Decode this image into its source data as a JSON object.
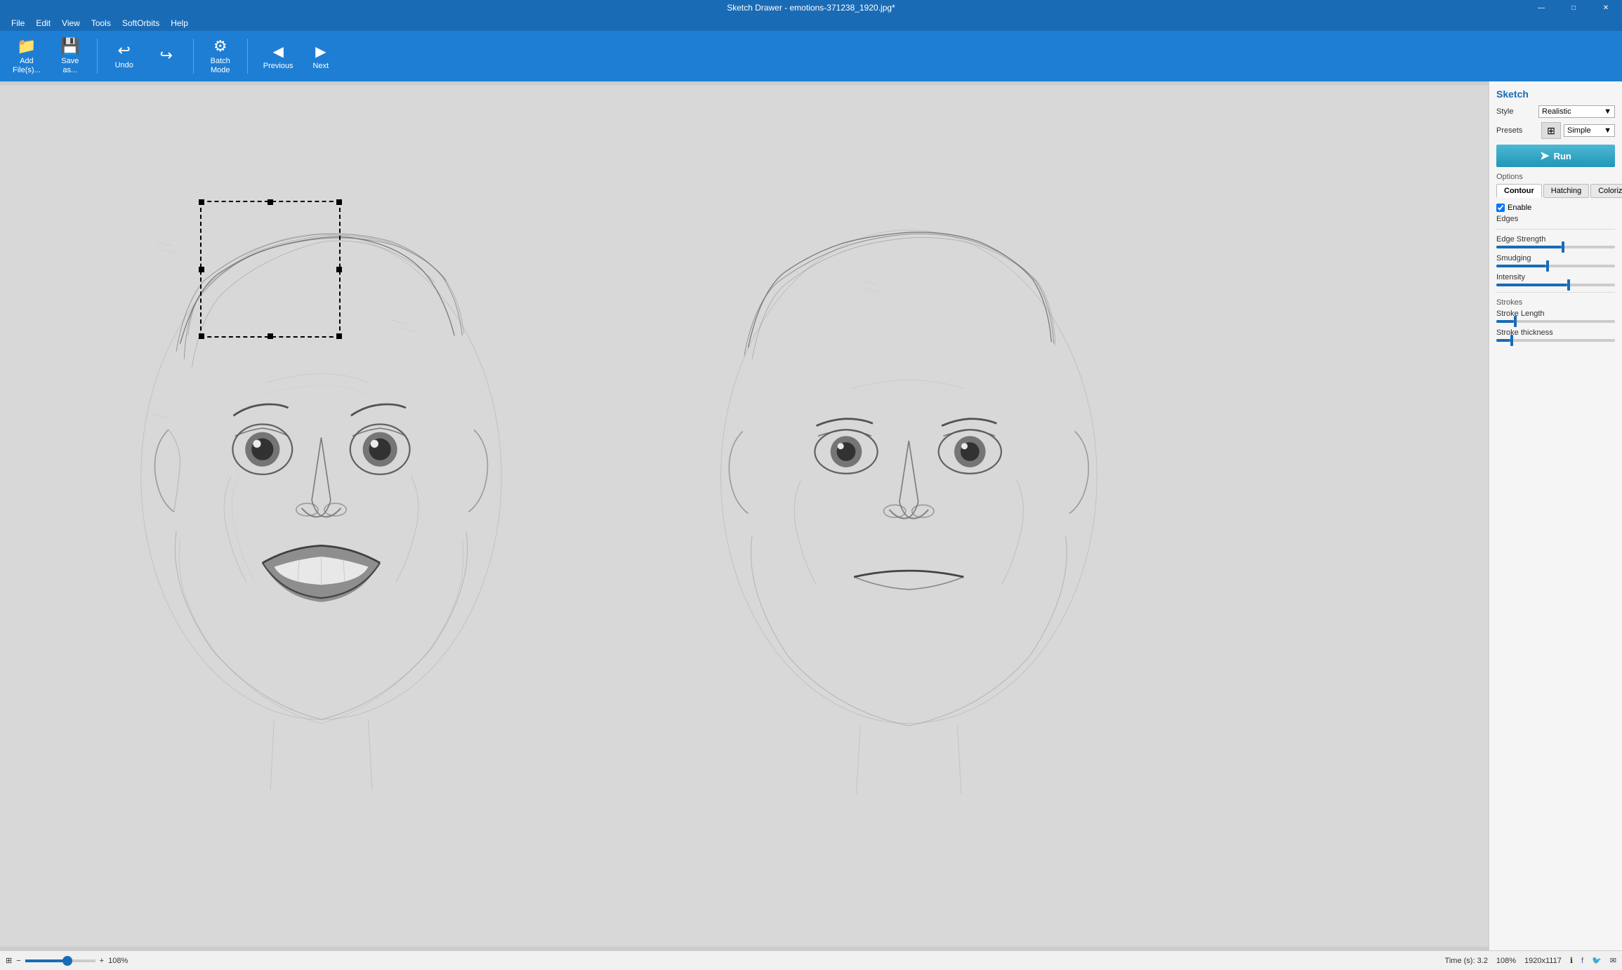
{
  "titleBar": {
    "title": "Sketch Drawer - emotions-371238_1920.jpg*",
    "minimize": "—",
    "maximize": "□",
    "close": "✕"
  },
  "menuBar": {
    "items": [
      "File",
      "Edit",
      "View",
      "Tools",
      "SoftOrbits",
      "Help"
    ]
  },
  "toolbar": {
    "addFiles": "Add\nFile(s)...",
    "saveAs": "Save\nas...",
    "undo": "Undo",
    "redo": "Redo",
    "batchMode": "Batch\nMode",
    "previous": "Previous",
    "next": "Next"
  },
  "rightPanel": {
    "title": "Sketch",
    "styleLabel": "Style",
    "styleValue": "Realistic",
    "presetsLabel": "Presets",
    "presetsValue": "Simple",
    "runButton": "Run",
    "optionsLabel": "Options",
    "tabs": [
      "Contour",
      "Hatching",
      "Colorize"
    ],
    "enableEdgesLabel": "Enable",
    "edgesLabel": "Edges",
    "edgeStrengthLabel": "Edge Strength",
    "edgeStrengthValue": 55,
    "smudgingLabel": "Smudging",
    "smudgingValue": 42,
    "intensityLabel": "Intensity",
    "intensityValue": 60,
    "strokesLabel": "Strokes",
    "strokeLengthLabel": "Stroke Length",
    "strokeLengthValue": 15,
    "strokeThicknessLabel": "Stroke thickness",
    "strokeThicknessValue": 12
  },
  "statusBar": {
    "timeLabel": "Time (s): 3.2",
    "zoom": "108%",
    "resolution": "1920x1117",
    "icons": [
      "info-icon",
      "facebook-icon",
      "twitter-icon",
      "mail-icon"
    ]
  }
}
